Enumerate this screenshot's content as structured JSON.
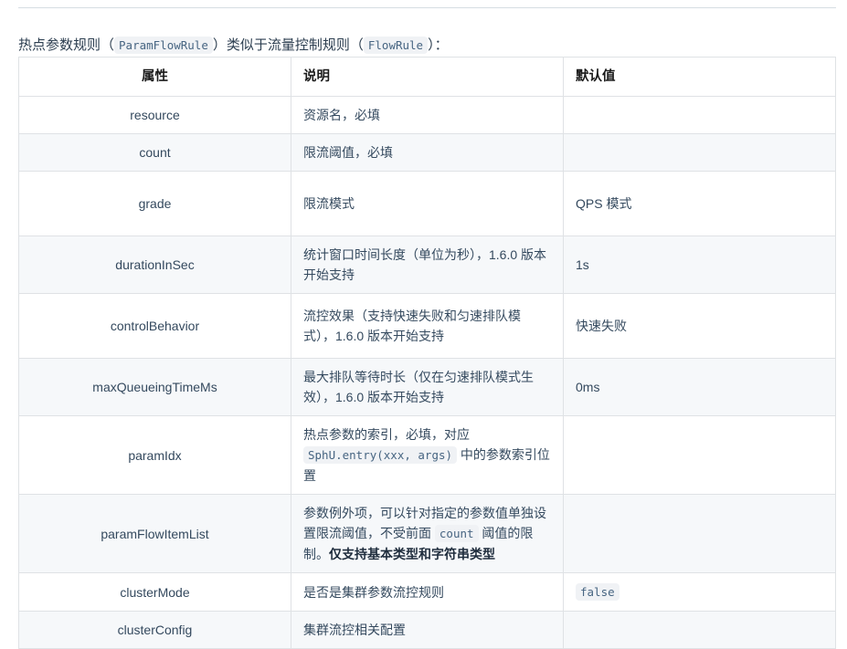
{
  "intro": {
    "segments": [
      {
        "type": "text",
        "value": "热点参数规则（"
      },
      {
        "type": "code",
        "value": "ParamFlowRule"
      },
      {
        "type": "text",
        "value": "）类似于流量控制规则（"
      },
      {
        "type": "code",
        "value": "FlowRule"
      },
      {
        "type": "text",
        "value": "）："
      }
    ],
    "text_1": "热点参数规则（",
    "code_1": "ParamFlowRule",
    "text_2": "）类似于流量控制规则（",
    "code_2": "FlowRule",
    "text_3": "）："
  },
  "table": {
    "headers": {
      "attribute": "属性",
      "description": "说明",
      "default": "默认值"
    },
    "rows": [
      {
        "attribute": "resource",
        "description": "资源名，必填",
        "default": ""
      },
      {
        "attribute": "count",
        "description": "限流阈值，必填",
        "default": ""
      },
      {
        "attribute": "grade",
        "description": "限流模式",
        "default": "QPS 模式"
      },
      {
        "attribute": "durationInSec",
        "description": "统计窗口时间长度（单位为秒），1.6.0 版本开始支持",
        "default": "1s"
      },
      {
        "attribute": "controlBehavior",
        "description": "流控效果（支持快速失败和匀速排队模式），1.6.0 版本开始支持",
        "default": "快速失败"
      },
      {
        "attribute": "maxQueueingTimeMs",
        "description": "最大排队等待时长（仅在匀速排队模式生效），1.6.0 版本开始支持",
        "default": "0ms"
      },
      {
        "attribute": "paramIdx",
        "description_prefix": "热点参数的索引，必填，对应 ",
        "description_code": "SphU.entry(xxx, args)",
        "description_suffix": " 中的参数索引位置",
        "default": ""
      },
      {
        "attribute": "paramFlowItemList",
        "description_prefix": "参数例外项，可以针对指定的参数值单独设置限流阈值，不受前面 ",
        "description_code": "count",
        "description_suffix": " 阈值的限制。",
        "description_bold": "仅支持基本类型和字符串类型",
        "default": ""
      },
      {
        "attribute": "clusterMode",
        "description": "是否是集群参数流控规则",
        "default_code": "false"
      },
      {
        "attribute": "clusterConfig",
        "description": "集群流控相关配置",
        "default": ""
      }
    ]
  },
  "colors": {
    "border": "#dfe2e5",
    "row_alt_bg": "#f6f8fa",
    "code_bg": "#f0f2f5",
    "code_fg": "#476582",
    "text": "#34495e",
    "rule": "#d6dde3"
  }
}
